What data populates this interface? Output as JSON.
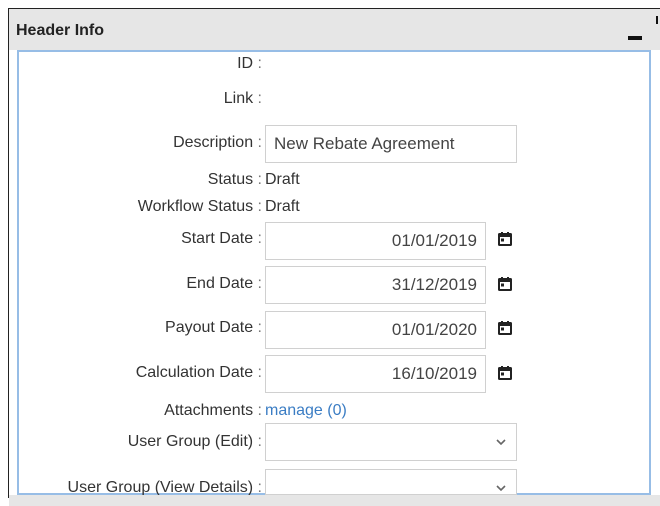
{
  "header": {
    "title": "Header Info"
  },
  "fields": {
    "id": {
      "label": "ID",
      "value": ""
    },
    "link": {
      "label": "Link",
      "value": ""
    },
    "description": {
      "label": "Description",
      "value": "New Rebate Agreement"
    },
    "status": {
      "label": "Status",
      "value": "Draft"
    },
    "workflow_status": {
      "label": "Workflow Status",
      "value": "Draft"
    },
    "start_date": {
      "label": "Start Date",
      "value": "01/01/2019"
    },
    "end_date": {
      "label": "End Date",
      "value": "31/12/2019"
    },
    "payout_date": {
      "label": "Payout Date",
      "value": "01/01/2020"
    },
    "calculation_date": {
      "label": "Calculation Date",
      "value": "16/10/2019"
    },
    "attachments": {
      "label": "Attachments",
      "link_text": "manage (0)"
    },
    "user_group_edit": {
      "label": "User Group (Edit)",
      "value": ""
    },
    "user_group_view": {
      "label": "User Group (View Details)",
      "value": ""
    }
  },
  "separator": ":",
  "icons": {
    "calendar": "calendar-icon",
    "dropdown": "chevron-down-icon",
    "minimize": "minimize-icon"
  },
  "colors": {
    "link": "#3b7dc4",
    "panel_border": "#97bde6",
    "header_bg": "#e6e6e6"
  }
}
